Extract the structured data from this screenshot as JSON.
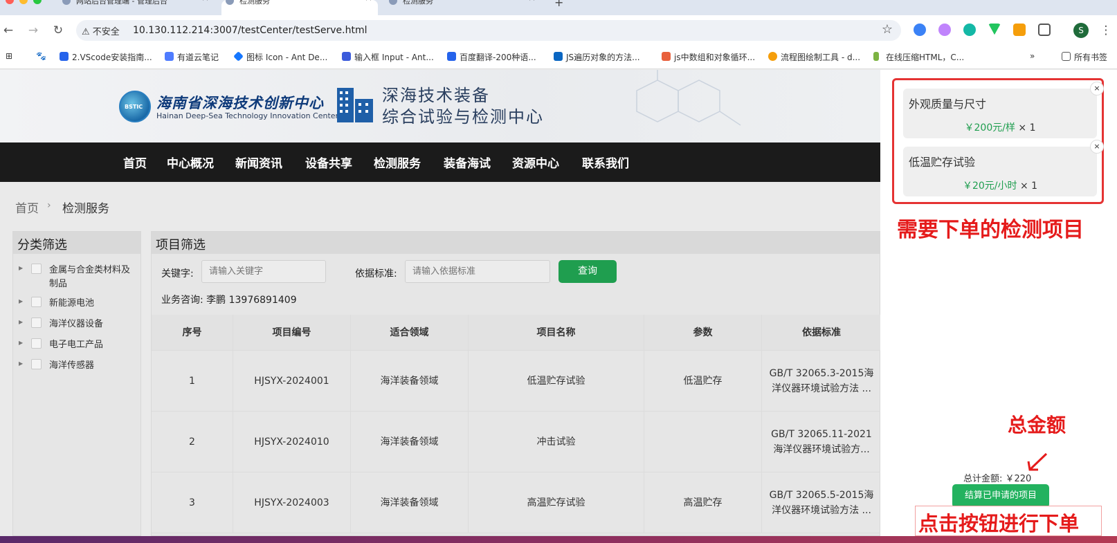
{
  "browser": {
    "tabs": [
      {
        "title": "网站后台管理端 - 管理后台"
      },
      {
        "title": "检测服务"
      },
      {
        "title": "检测服务"
      }
    ],
    "new_tab": "+",
    "insecure_label": "不安全",
    "url": "10.130.112.214:3007/testCenter/testServe.html",
    "profile_initial": "S",
    "bookmarks": [
      "2.VScode安装指南...",
      "有道云笔记",
      "图标 Icon - Ant De...",
      "输入框 Input - Ant...",
      "百度翻译-200种语...",
      "JS遍历对象的方法...",
      "js中数组和对象循环...",
      "流程图绘制工具 - d...",
      "在线压缩HTML，C..."
    ],
    "all_bookmarks": "所有书签",
    "more": "»"
  },
  "site": {
    "logo_text": "BSTIC",
    "org_name_cn": "海南省深海技术创新中心",
    "org_name_en": "Hainan Deep-Sea Technology Innovation Center",
    "center_title_line1": "深海技术装备",
    "center_title_line2": "综合试验与检测中心",
    "nav": [
      "首页",
      "中心概况",
      "新闻资讯",
      "设备共享",
      "检测服务",
      "装备海试",
      "资源中心",
      "联系我们"
    ],
    "breadcrumb": {
      "home": "首页",
      "sep": "›",
      "current": "检测服务"
    },
    "sidebar": {
      "title": "分类筛选",
      "categories": [
        "金属与合金类材料及制品",
        "新能源电池",
        "海洋仪器设备",
        "电子电工产品",
        "海洋传感器"
      ]
    },
    "filter": {
      "title": "项目筛选",
      "keyword_label": "关键字:",
      "keyword_placeholder": "请输入关键字",
      "standard_label": "依据标准:",
      "standard_placeholder": "请输入依据标准",
      "query_button": "查询",
      "consult": "业务咨询: 李鹏 13976891409"
    },
    "table": {
      "headers": [
        "序号",
        "项目编号",
        "适合领域",
        "项目名称",
        "参数",
        "依据标准"
      ],
      "rows": [
        [
          "1",
          "HJSYX-2024001",
          "海洋装备领域",
          "低温贮存试验",
          "低温贮存",
          "GB/T 32065.3-2015海洋仪器环境试验方法 ..."
        ],
        [
          "2",
          "HJSYX-2024010",
          "海洋装备领域",
          "冲击试验",
          "",
          "GB/T 32065.11-2021 海洋仪器环境试验方..."
        ],
        [
          "3",
          "HJSYX-2024003",
          "海洋装备领域",
          "高温贮存试验",
          "高温贮存",
          "GB/T 32065.5-2015海洋仪器环境试验方法 ..."
        ]
      ]
    }
  },
  "cart": {
    "items": [
      {
        "name": "外观质量与尺寸",
        "price": "￥200元/样",
        "qty": "× 1"
      },
      {
        "name": "低温贮存试验",
        "price": "￥20元/小时",
        "qty": "× 1"
      }
    ],
    "close": "×",
    "annotation_items": "需要下单的检测项目",
    "annotation_total": "总金额",
    "total_label": "总计金额: ￥220",
    "settle_button": "结算已申请的项目",
    "annotation_button": "点击按钮进行下单"
  },
  "colors": {
    "accent_green": "#1f9e4f",
    "annotation_red": "#e51b1b",
    "nav_bg": "#1b1b1b"
  }
}
